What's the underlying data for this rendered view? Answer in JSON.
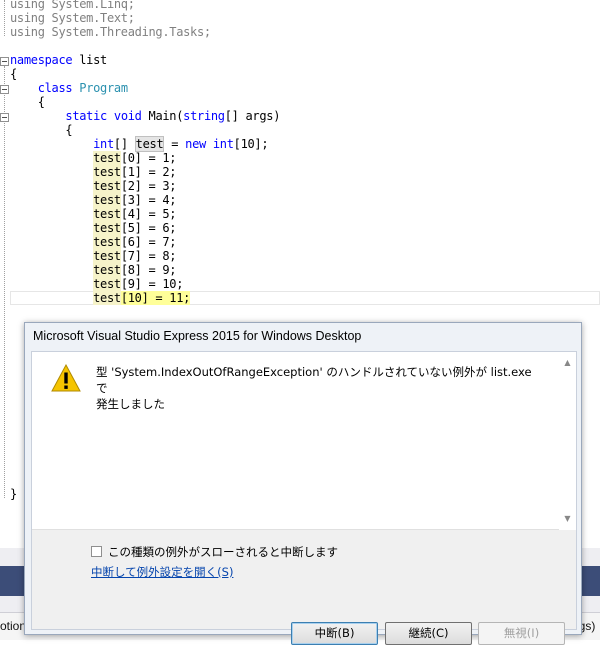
{
  "editor": {
    "lines": [
      {
        "indent": "",
        "parts": [
          {
            "t": "using System.Linq;",
            "c": "ns-dim"
          }
        ]
      },
      {
        "indent": "",
        "parts": [
          {
            "t": "using System.Text;",
            "c": "ns-dim"
          }
        ]
      },
      {
        "indent": "",
        "parts": [
          {
            "t": "using System.Threading.Tasks;",
            "c": "ns-dim"
          }
        ]
      },
      {
        "indent": "",
        "parts": []
      },
      {
        "indent": "",
        "parts": [
          {
            "t": "namespace",
            "c": "kw"
          },
          {
            "t": " list",
            "c": ""
          }
        ]
      },
      {
        "indent": "",
        "parts": [
          {
            "t": "{",
            "c": ""
          }
        ]
      },
      {
        "indent": "    ",
        "parts": [
          {
            "t": "class",
            "c": "kw"
          },
          {
            "t": " ",
            "c": ""
          },
          {
            "t": "Program",
            "c": "ty"
          }
        ]
      },
      {
        "indent": "    ",
        "parts": [
          {
            "t": "{",
            "c": ""
          }
        ]
      },
      {
        "indent": "        ",
        "parts": [
          {
            "t": "static",
            "c": "kw"
          },
          {
            "t": " ",
            "c": ""
          },
          {
            "t": "void",
            "c": "kw"
          },
          {
            "t": " Main(",
            "c": ""
          },
          {
            "t": "string",
            "c": "kw"
          },
          {
            "t": "[] args)",
            "c": ""
          }
        ]
      },
      {
        "indent": "        ",
        "parts": [
          {
            "t": "{",
            "c": ""
          }
        ]
      },
      {
        "indent": "            ",
        "parts": [
          {
            "t": "int",
            "c": "kw"
          },
          {
            "t": "[] ",
            "c": ""
          },
          {
            "t": "test",
            "c": "ref-box"
          },
          {
            "t": " = ",
            "c": ""
          },
          {
            "t": "new",
            "c": "kw"
          },
          {
            "t": " ",
            "c": ""
          },
          {
            "t": "int",
            "c": "kw"
          },
          {
            "t": "[10];",
            "c": ""
          }
        ]
      },
      {
        "indent": "            ",
        "parts": [
          {
            "t": "test",
            "c": "hl"
          },
          {
            "t": "[0] = 1;",
            "c": ""
          }
        ]
      },
      {
        "indent": "            ",
        "parts": [
          {
            "t": "test",
            "c": "hl"
          },
          {
            "t": "[1] = 2;",
            "c": ""
          }
        ]
      },
      {
        "indent": "            ",
        "parts": [
          {
            "t": "test",
            "c": "hl"
          },
          {
            "t": "[2] = 3;",
            "c": ""
          }
        ]
      },
      {
        "indent": "            ",
        "parts": [
          {
            "t": "test",
            "c": "hl"
          },
          {
            "t": "[3] = 4;",
            "c": ""
          }
        ]
      },
      {
        "indent": "            ",
        "parts": [
          {
            "t": "test",
            "c": "hl"
          },
          {
            "t": "[4] = 5;",
            "c": ""
          }
        ]
      },
      {
        "indent": "            ",
        "parts": [
          {
            "t": "test",
            "c": "hl"
          },
          {
            "t": "[5] = 6;",
            "c": ""
          }
        ]
      },
      {
        "indent": "            ",
        "parts": [
          {
            "t": "test",
            "c": "hl"
          },
          {
            "t": "[6] = 7;",
            "c": ""
          }
        ]
      },
      {
        "indent": "            ",
        "parts": [
          {
            "t": "test",
            "c": "hl"
          },
          {
            "t": "[7] = 8;",
            "c": ""
          }
        ]
      },
      {
        "indent": "            ",
        "parts": [
          {
            "t": "test",
            "c": "hl"
          },
          {
            "t": "[8] = 9;",
            "c": ""
          }
        ]
      },
      {
        "indent": "            ",
        "parts": [
          {
            "t": "test",
            "c": "hl"
          },
          {
            "t": "[9] = 10;",
            "c": ""
          }
        ]
      },
      {
        "indent": "            ",
        "parts": [
          {
            "t": "test",
            "c": "hl"
          },
          {
            "t": "[10] = 11;",
            "c": "hl-err"
          }
        ]
      }
    ],
    "closing_brace": "}"
  },
  "ide": {
    "left_fragment": "otion",
    "right_fragment": "args)"
  },
  "dialog": {
    "title": "Microsoft Visual Studio Express 2015 for Windows Desktop",
    "icon": "warning-icon",
    "message_line1": "型 'System.IndexOutOfRangeException' のハンドルされていない例外が list.exe で",
    "message_line2": "発生しました",
    "checkbox_label": "この種類の例外がスローされると中断します",
    "checkbox_checked": false,
    "link_label": "中断して例外設定を開く(S)",
    "buttons": {
      "break": "中断(B)",
      "continue": "継続(C)",
      "ignore": "無視(I)"
    }
  },
  "colors": {
    "keyword": "#0000ff",
    "type": "#2b91af",
    "ide_bar": "#3c4d78"
  }
}
